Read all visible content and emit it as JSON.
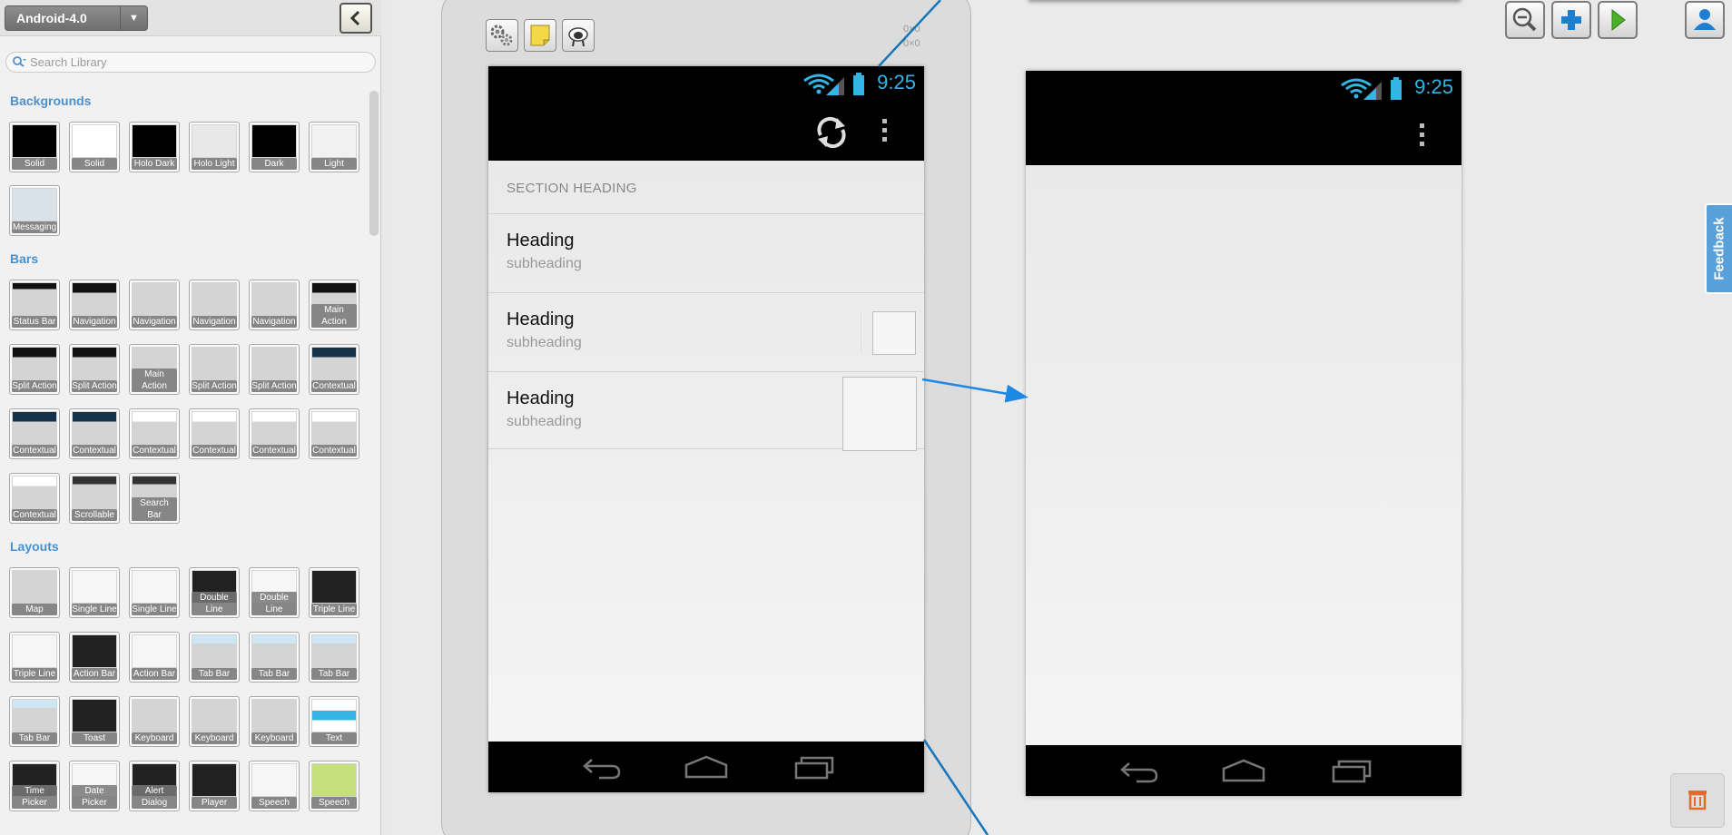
{
  "library": {
    "platform": "Android-4.0",
    "search_placeholder": "Search Library",
    "sections": [
      {
        "title": "Backgrounds",
        "items": [
          "Solid",
          "Solid",
          "Holo Dark",
          "Holo Light",
          "Dark",
          "Light",
          "Messaging"
        ]
      },
      {
        "title": "Bars",
        "items": [
          "Status Bar",
          "Navigation",
          "Navigation",
          "Navigation",
          "Navigation",
          "Main Action",
          "Split Action",
          "Split Action",
          "Main Action",
          "Split Action",
          "Split Action",
          "Contextual",
          "Contextual",
          "Contextual",
          "Contextual",
          "Contextual",
          "Contextual",
          "Contextual",
          "Contextual",
          "Scrollable",
          "Search Bar"
        ]
      },
      {
        "title": "Layouts",
        "items": [
          "Map",
          "Single Line",
          "Single Line",
          "Double Line",
          "Double Line",
          "Triple Line",
          "Triple Line",
          "Action Bar",
          "Action Bar",
          "Tab Bar",
          "Tab Bar",
          "Tab Bar",
          "Tab Bar",
          "Toast",
          "Keyboard",
          "Keyboard",
          "Keyboard",
          "Text",
          "Time Picker",
          "Date Picker",
          "Alert Dialog",
          "Player",
          "Speech",
          "Speech"
        ]
      }
    ]
  },
  "canvas": {
    "frame_dimensions": [
      "0×0",
      "0×0"
    ],
    "screen1": {
      "time": "9:25",
      "section_heading": "SECTION HEADING",
      "rows": [
        {
          "heading": "Heading",
          "subheading": "subheading"
        },
        {
          "heading": "Heading",
          "subheading": "subheading"
        },
        {
          "heading": "Heading",
          "subheading": "subheading"
        }
      ]
    },
    "screen2": {
      "time": "9:25"
    }
  },
  "toolbar": {
    "feedback_label": "Feedback"
  },
  "colors": {
    "accent": "#33b5e5",
    "section_title": "#4a90cf",
    "connector": "#1e88c8",
    "feedback": "#5aa0d8"
  }
}
